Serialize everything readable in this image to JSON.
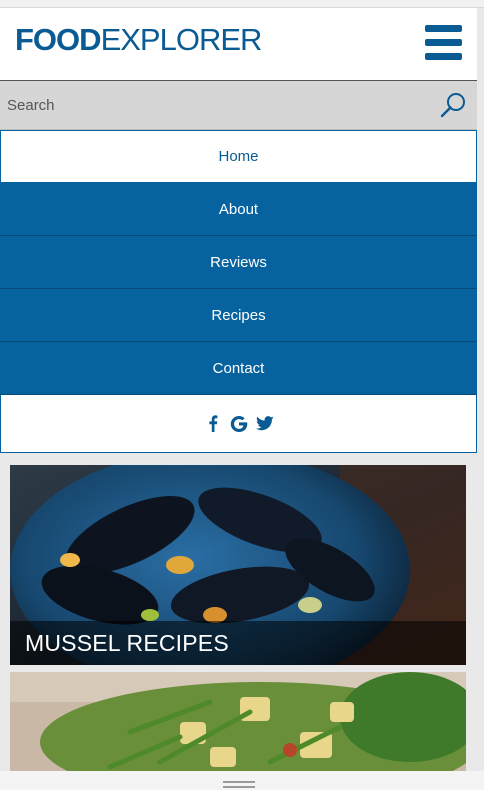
{
  "header": {
    "logo_bold": "FOOD",
    "logo_light": "EXPLORER",
    "menu_icon": "hamburger-menu-icon"
  },
  "search": {
    "placeholder": "Search",
    "icon": "search-icon"
  },
  "nav": {
    "items": [
      {
        "label": "Home",
        "active": true
      },
      {
        "label": "About"
      },
      {
        "label": "Reviews"
      },
      {
        "label": "Recipes"
      },
      {
        "label": "Contact"
      }
    ],
    "social_icons": [
      "facebook-icon",
      "google-icon",
      "twitter-icon"
    ]
  },
  "cards": [
    {
      "title": "MUSSEL RECIPES",
      "image": "mussels-photo"
    },
    {
      "title": "",
      "image": "potato-green-bean-salad-photo"
    }
  ],
  "colors": {
    "brand_blue": "#0a5b93",
    "nav_blue": "#06639f",
    "header_bg": "#ffffff",
    "search_bg": "#d6d6d6"
  }
}
